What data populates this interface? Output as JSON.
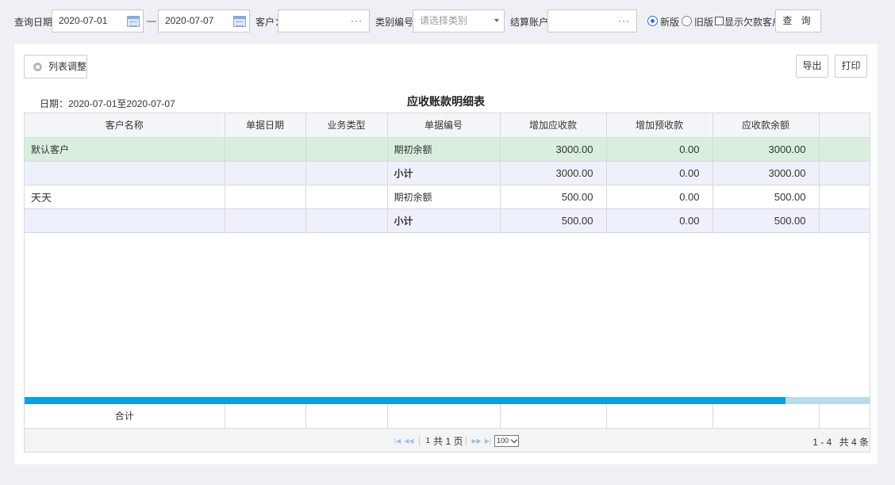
{
  "filters": {
    "query_date_label": "查询日期：",
    "date_from": "2020-07-01",
    "date_sep": "—",
    "date_to": "2020-07-07",
    "customer_label": "客户：",
    "customer_value": "",
    "category_label": "类别编号：",
    "category_placeholder": "请选择类别",
    "account_label": "结算账户：",
    "account_value": "",
    "ellipsis": "···",
    "radio_new": "新版",
    "radio_old": "旧版",
    "show_debt_label": "显示欠款客户",
    "query_button": "查 询"
  },
  "toolbar": {
    "list_adjust": "列表调整",
    "export": "导出",
    "print": "打印"
  },
  "report": {
    "date_range": "日期：2020-07-01至2020-07-07",
    "title": "应收账款明细表"
  },
  "table": {
    "headers": [
      "客户名称",
      "单据日期",
      "业务类型",
      "单据编号",
      "增加应收款",
      "增加预收款",
      "应收款余额",
      ""
    ],
    "rows": [
      {
        "customer": "默认客户",
        "date": "",
        "type": "",
        "doc": "期初余额",
        "inc_receivable": "3000.00",
        "inc_prepaid": "0.00",
        "balance": "3000.00"
      },
      {
        "customer": "",
        "date": "",
        "type": "",
        "doc": "小计",
        "inc_receivable": "3000.00",
        "inc_prepaid": "0.00",
        "balance": "3000.00"
      },
      {
        "customer": "天天",
        "date": "",
        "type": "",
        "doc": "期初余额",
        "inc_receivable": "500.00",
        "inc_prepaid": "0.00",
        "balance": "500.00"
      },
      {
        "customer": "",
        "date": "",
        "type": "",
        "doc": "小计",
        "inc_receivable": "500.00",
        "inc_prepaid": "0.00",
        "balance": "500.00"
      }
    ],
    "total_label": "合计",
    "horizontal_scroll_fraction": 0.9
  },
  "pager": {
    "page_input": "1",
    "total_pages": "共 1 页",
    "page_size": "100",
    "range": "1 - 4",
    "total_records": "共 4 条"
  }
}
